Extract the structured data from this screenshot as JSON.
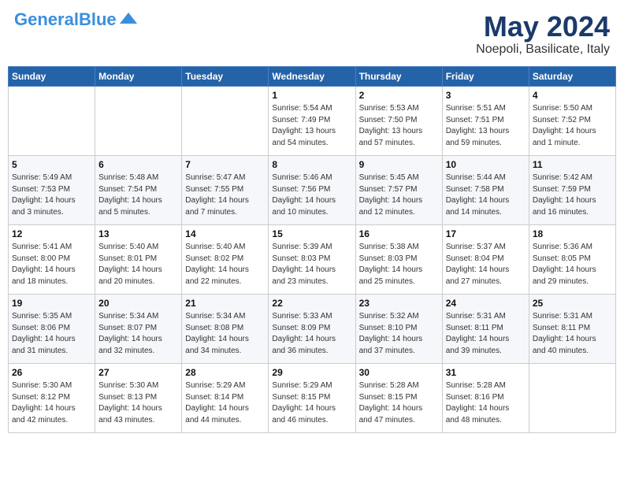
{
  "header": {
    "logo_general": "General",
    "logo_blue": "Blue",
    "month": "May 2024",
    "location": "Noepoli, Basilicate, Italy"
  },
  "days_of_week": [
    "Sunday",
    "Monday",
    "Tuesday",
    "Wednesday",
    "Thursday",
    "Friday",
    "Saturday"
  ],
  "weeks": [
    [
      {
        "day": "",
        "info": ""
      },
      {
        "day": "",
        "info": ""
      },
      {
        "day": "",
        "info": ""
      },
      {
        "day": "1",
        "info": "Sunrise: 5:54 AM\nSunset: 7:49 PM\nDaylight: 13 hours\nand 54 minutes."
      },
      {
        "day": "2",
        "info": "Sunrise: 5:53 AM\nSunset: 7:50 PM\nDaylight: 13 hours\nand 57 minutes."
      },
      {
        "day": "3",
        "info": "Sunrise: 5:51 AM\nSunset: 7:51 PM\nDaylight: 13 hours\nand 59 minutes."
      },
      {
        "day": "4",
        "info": "Sunrise: 5:50 AM\nSunset: 7:52 PM\nDaylight: 14 hours\nand 1 minute."
      }
    ],
    [
      {
        "day": "5",
        "info": "Sunrise: 5:49 AM\nSunset: 7:53 PM\nDaylight: 14 hours\nand 3 minutes."
      },
      {
        "day": "6",
        "info": "Sunrise: 5:48 AM\nSunset: 7:54 PM\nDaylight: 14 hours\nand 5 minutes."
      },
      {
        "day": "7",
        "info": "Sunrise: 5:47 AM\nSunset: 7:55 PM\nDaylight: 14 hours\nand 7 minutes."
      },
      {
        "day": "8",
        "info": "Sunrise: 5:46 AM\nSunset: 7:56 PM\nDaylight: 14 hours\nand 10 minutes."
      },
      {
        "day": "9",
        "info": "Sunrise: 5:45 AM\nSunset: 7:57 PM\nDaylight: 14 hours\nand 12 minutes."
      },
      {
        "day": "10",
        "info": "Sunrise: 5:44 AM\nSunset: 7:58 PM\nDaylight: 14 hours\nand 14 minutes."
      },
      {
        "day": "11",
        "info": "Sunrise: 5:42 AM\nSunset: 7:59 PM\nDaylight: 14 hours\nand 16 minutes."
      }
    ],
    [
      {
        "day": "12",
        "info": "Sunrise: 5:41 AM\nSunset: 8:00 PM\nDaylight: 14 hours\nand 18 minutes."
      },
      {
        "day": "13",
        "info": "Sunrise: 5:40 AM\nSunset: 8:01 PM\nDaylight: 14 hours\nand 20 minutes."
      },
      {
        "day": "14",
        "info": "Sunrise: 5:40 AM\nSunset: 8:02 PM\nDaylight: 14 hours\nand 22 minutes."
      },
      {
        "day": "15",
        "info": "Sunrise: 5:39 AM\nSunset: 8:03 PM\nDaylight: 14 hours\nand 23 minutes."
      },
      {
        "day": "16",
        "info": "Sunrise: 5:38 AM\nSunset: 8:03 PM\nDaylight: 14 hours\nand 25 minutes."
      },
      {
        "day": "17",
        "info": "Sunrise: 5:37 AM\nSunset: 8:04 PM\nDaylight: 14 hours\nand 27 minutes."
      },
      {
        "day": "18",
        "info": "Sunrise: 5:36 AM\nSunset: 8:05 PM\nDaylight: 14 hours\nand 29 minutes."
      }
    ],
    [
      {
        "day": "19",
        "info": "Sunrise: 5:35 AM\nSunset: 8:06 PM\nDaylight: 14 hours\nand 31 minutes."
      },
      {
        "day": "20",
        "info": "Sunrise: 5:34 AM\nSunset: 8:07 PM\nDaylight: 14 hours\nand 32 minutes."
      },
      {
        "day": "21",
        "info": "Sunrise: 5:34 AM\nSunset: 8:08 PM\nDaylight: 14 hours\nand 34 minutes."
      },
      {
        "day": "22",
        "info": "Sunrise: 5:33 AM\nSunset: 8:09 PM\nDaylight: 14 hours\nand 36 minutes."
      },
      {
        "day": "23",
        "info": "Sunrise: 5:32 AM\nSunset: 8:10 PM\nDaylight: 14 hours\nand 37 minutes."
      },
      {
        "day": "24",
        "info": "Sunrise: 5:31 AM\nSunset: 8:11 PM\nDaylight: 14 hours\nand 39 minutes."
      },
      {
        "day": "25",
        "info": "Sunrise: 5:31 AM\nSunset: 8:11 PM\nDaylight: 14 hours\nand 40 minutes."
      }
    ],
    [
      {
        "day": "26",
        "info": "Sunrise: 5:30 AM\nSunset: 8:12 PM\nDaylight: 14 hours\nand 42 minutes."
      },
      {
        "day": "27",
        "info": "Sunrise: 5:30 AM\nSunset: 8:13 PM\nDaylight: 14 hours\nand 43 minutes."
      },
      {
        "day": "28",
        "info": "Sunrise: 5:29 AM\nSunset: 8:14 PM\nDaylight: 14 hours\nand 44 minutes."
      },
      {
        "day": "29",
        "info": "Sunrise: 5:29 AM\nSunset: 8:15 PM\nDaylight: 14 hours\nand 46 minutes."
      },
      {
        "day": "30",
        "info": "Sunrise: 5:28 AM\nSunset: 8:15 PM\nDaylight: 14 hours\nand 47 minutes."
      },
      {
        "day": "31",
        "info": "Sunrise: 5:28 AM\nSunset: 8:16 PM\nDaylight: 14 hours\nand 48 minutes."
      },
      {
        "day": "",
        "info": ""
      }
    ]
  ]
}
